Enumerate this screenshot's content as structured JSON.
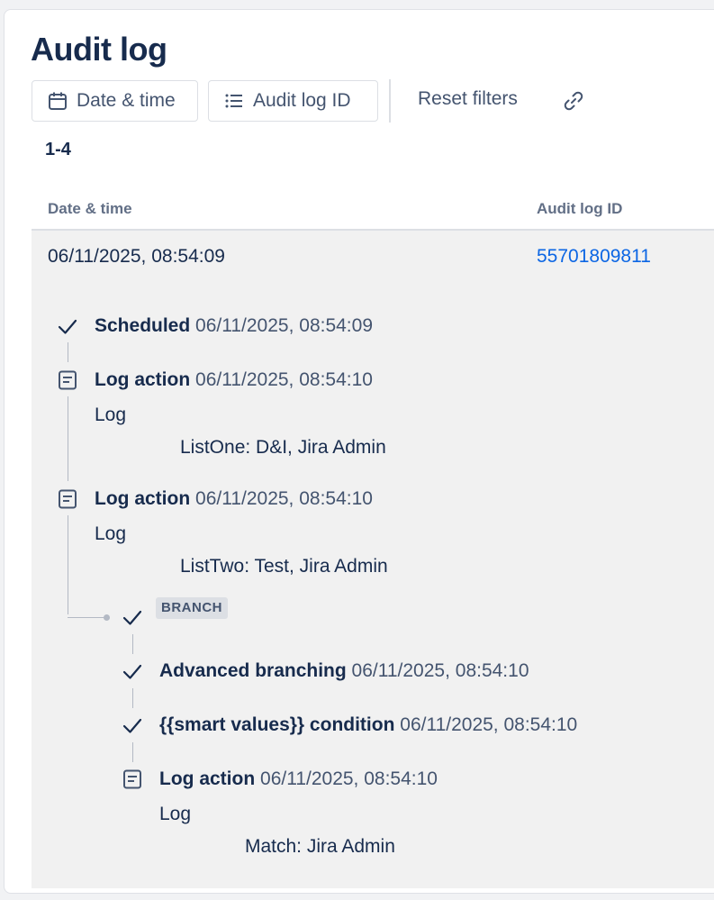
{
  "page": {
    "title": "Audit log"
  },
  "filters": {
    "date_time": "Date & time",
    "audit_log_id": "Audit log ID",
    "reset": "Reset filters"
  },
  "count": "1-4",
  "table": {
    "columns": [
      "Date & time",
      "Audit log ID"
    ],
    "row": {
      "date_time": "06/11/2025, 08:54:09",
      "audit_log_id": "55701809811"
    }
  },
  "steps": [
    {
      "icon": "check-icon",
      "label": "Scheduled",
      "time": "06/11/2025, 08:54:09"
    },
    {
      "icon": "log-icon",
      "label": "Log action",
      "time": "06/11/2025, 08:54:10",
      "sub_label": "Log",
      "message": "ListOne: D&I, Jira Admin"
    },
    {
      "icon": "log-icon",
      "label": "Log action",
      "time": "06/11/2025, 08:54:10",
      "sub_label": "Log",
      "message": "ListTwo: Test, Jira Admin"
    }
  ],
  "branch": {
    "badge": "BRANCH",
    "steps": [
      {
        "icon": "check-icon",
        "label": "Advanced branching",
        "time": "06/11/2025, 08:54:10"
      },
      {
        "icon": "check-icon",
        "label": "{{smart values}} condition",
        "time": "06/11/2025, 08:54:10"
      },
      {
        "icon": "log-icon",
        "label": "Log action",
        "time": "06/11/2025, 08:54:10",
        "sub_label": "Log",
        "message": "Match: Jira Admin"
      }
    ]
  }
}
